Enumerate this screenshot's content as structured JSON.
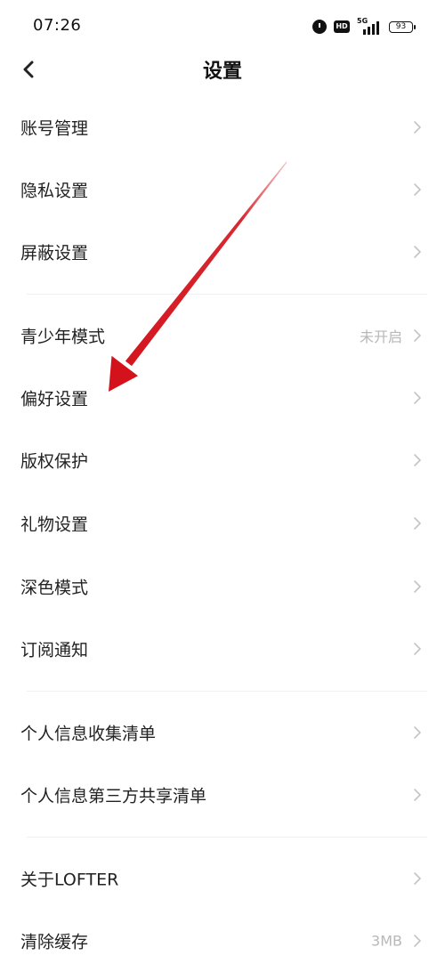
{
  "status_bar": {
    "time": "07:26",
    "network": "5G",
    "battery": "93"
  },
  "header": {
    "title": "设置"
  },
  "settings": {
    "items": [
      {
        "label": "账号管理",
        "value": ""
      },
      {
        "label": "隐私设置",
        "value": ""
      },
      {
        "label": "屏蔽设置",
        "value": ""
      },
      {
        "label": "青少年模式",
        "value": "未开启"
      },
      {
        "label": "偏好设置",
        "value": ""
      },
      {
        "label": "版权保护",
        "value": ""
      },
      {
        "label": "礼物设置",
        "value": ""
      },
      {
        "label": "深色模式",
        "value": ""
      },
      {
        "label": "订阅通知",
        "value": ""
      },
      {
        "label": "个人信息收集清单",
        "value": ""
      },
      {
        "label": "个人信息第三方共享清单",
        "value": ""
      },
      {
        "label": "关于LOFTER",
        "value": ""
      },
      {
        "label": "清除缓存",
        "value": "3MB"
      }
    ]
  },
  "colors": {
    "annotation_arrow": "#d3121b",
    "chevron": "#c4c4c4",
    "secondary_text": "#b8b8b8"
  },
  "icons": {
    "back": "chevron-left-icon",
    "row_arrow": "chevron-right-icon"
  }
}
